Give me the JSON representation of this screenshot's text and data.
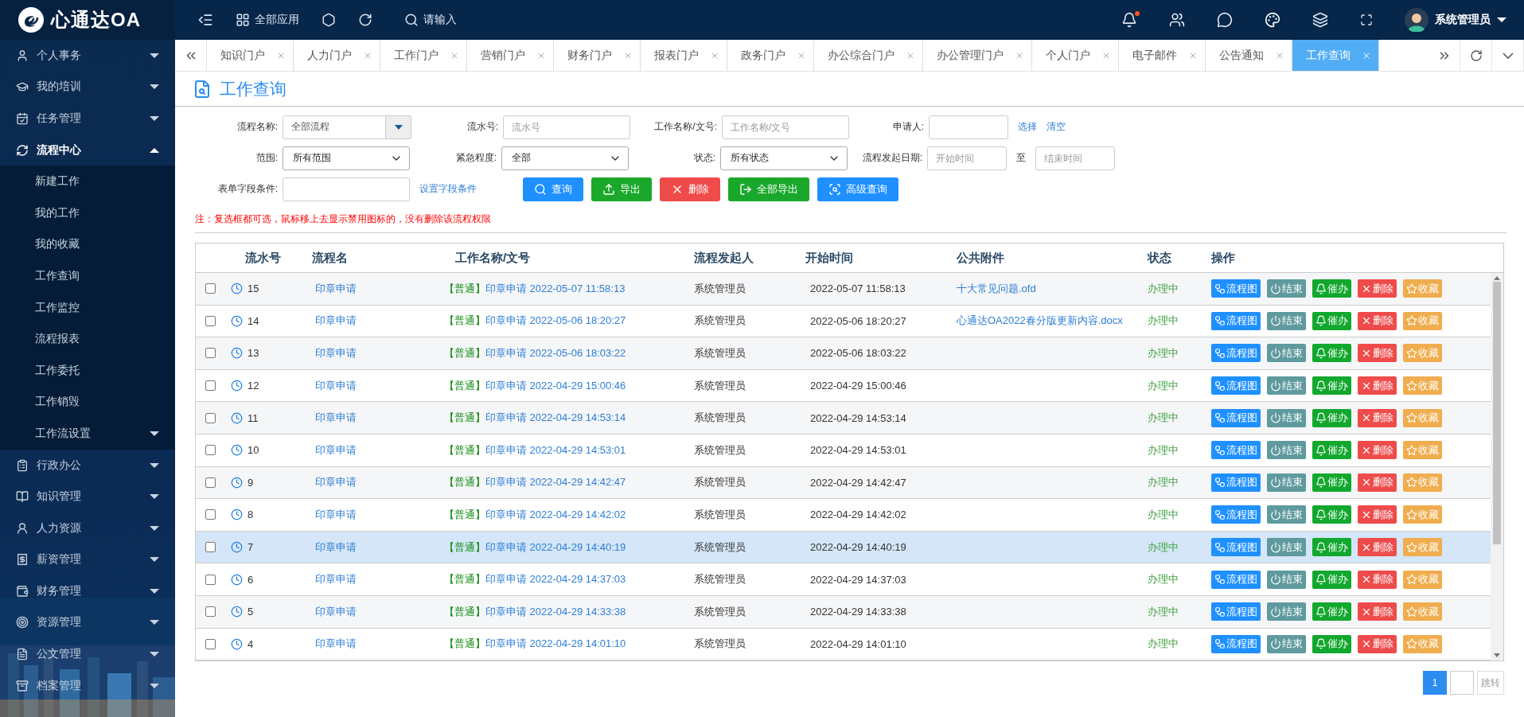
{
  "topbar": {
    "logo": "心通达OA",
    "apps_label": "全部应用",
    "search_placeholder": "请输入",
    "bell_unread": true,
    "user": "系统管理员"
  },
  "sidebar": {
    "items": [
      {
        "label": "个人事务",
        "expanded": false
      },
      {
        "label": "我的培训",
        "expanded": false
      },
      {
        "label": "任务管理",
        "expanded": false
      },
      {
        "label": "流程中心",
        "expanded": true,
        "children": [
          {
            "label": "新建工作"
          },
          {
            "label": "我的工作"
          },
          {
            "label": "我的收藏"
          },
          {
            "label": "工作查询"
          },
          {
            "label": "工作监控"
          },
          {
            "label": "流程报表"
          },
          {
            "label": "工作委托"
          },
          {
            "label": "工作销毁"
          },
          {
            "label": "工作流设置",
            "expanded": false
          }
        ]
      },
      {
        "label": "行政办公",
        "expanded": false
      },
      {
        "label": "知识管理",
        "expanded": false
      },
      {
        "label": "人力资源",
        "expanded": false
      },
      {
        "label": "薪资管理",
        "expanded": false
      },
      {
        "label": "财务管理",
        "expanded": false
      },
      {
        "label": "资源管理",
        "expanded": false
      },
      {
        "label": "公文管理",
        "expanded": false
      },
      {
        "label": "档案管理",
        "expanded": false
      }
    ]
  },
  "tabs": [
    {
      "label": "知识门户",
      "selected": false
    },
    {
      "label": "人力门户",
      "selected": false
    },
    {
      "label": "工作门户",
      "selected": false
    },
    {
      "label": "营销门户",
      "selected": false
    },
    {
      "label": "财务门户",
      "selected": false
    },
    {
      "label": "报表门户",
      "selected": false
    },
    {
      "label": "政务门户",
      "selected": false
    },
    {
      "label": "办公综合门户",
      "selected": false
    },
    {
      "label": "办公管理门户",
      "selected": false
    },
    {
      "label": "个人门户",
      "selected": false
    },
    {
      "label": "电子邮件",
      "selected": false
    },
    {
      "label": "公告通知",
      "selected": false
    },
    {
      "label": "工作查询",
      "selected": true
    }
  ],
  "page_title": "工作查询",
  "filters": {
    "rows": [
      [
        {
          "label": "流程名称:",
          "kind": "combo",
          "value": "全部流程"
        },
        {
          "label": "流水号:",
          "kind": "input",
          "placeholder": "流水号"
        },
        {
          "label": "工作名称/文号:",
          "kind": "input",
          "placeholder": "工作名称/文号"
        },
        {
          "label": "申请人:",
          "kind": "input"
        },
        {
          "kind": "links",
          "links": [
            "选择",
            "清空"
          ]
        }
      ],
      [
        {
          "label": "范围:",
          "kind": "select",
          "value": "所有范围"
        },
        {
          "label": "紧急程度:",
          "kind": "select",
          "value": "全部"
        },
        {
          "label": "状态:",
          "kind": "select",
          "value": "所有状态"
        },
        {
          "label": "流程发起日期:",
          "kind": "input",
          "placeholder": "开始时间"
        },
        {
          "kind": "range",
          "text": "至",
          "placeholder": "结束时间"
        }
      ],
      [
        {
          "label": "表单字段条件:",
          "kind": "input"
        },
        {
          "kind": "link",
          "text": "设置字段条件"
        }
      ]
    ],
    "buttons": [
      {
        "label": "查询",
        "kind": "search"
      },
      {
        "label": "导出",
        "kind": "export"
      },
      {
        "label": "删除",
        "kind": "delete"
      },
      {
        "label": "全部导出",
        "kind": "export_all"
      },
      {
        "label": "高级查询",
        "kind": "advanced"
      }
    ],
    "note": "注：复选框都可选，鼠标移上去显示禁用图标的，没有删除该流程权限"
  },
  "table": {
    "columns": [
      "流水号",
      "流程名",
      "工作名称/文号",
      "流程发起人",
      "开始时间",
      "公共附件",
      "状态",
      "操作"
    ],
    "rows": [
      {
        "checked": false,
        "selected": false,
        "no": "15",
        "flow": "印章申请",
        "priority": "【普通】",
        "title": "印章申请 2022-05-07 11:58:13",
        "starter": "系统管理员",
        "start": "2022-05-07 11:58:13",
        "attachment": "十大常见问题.ofd",
        "status": "办理中",
        "actions": [
          {
            "label": "流程图",
            "kind": "chart"
          },
          {
            "label": "结束",
            "kind": "end"
          },
          {
            "label": "催办",
            "kind": "remind"
          },
          {
            "label": "删除",
            "kind": "delete"
          },
          {
            "label": "收藏",
            "kind": "favorite"
          }
        ]
      },
      {
        "checked": false,
        "selected": false,
        "no": "14",
        "flow": "印章申请",
        "priority": "【普通】",
        "title": "印章申请 2022-05-06 18:20:27",
        "starter": "系统管理员",
        "start": "2022-05-06 18:20:27",
        "attachment": "心通达OA2022春分版更新内容.docx",
        "status": "办理中",
        "actions": [
          {
            "label": "流程图",
            "kind": "chart"
          },
          {
            "label": "结束",
            "kind": "end"
          },
          {
            "label": "催办",
            "kind": "remind"
          },
          {
            "label": "删除",
            "kind": "delete"
          },
          {
            "label": "收藏",
            "kind": "favorite"
          }
        ]
      },
      {
        "checked": false,
        "selected": false,
        "no": "13",
        "flow": "印章申请",
        "priority": "【普通】",
        "title": "印章申请 2022-05-06 18:03:22",
        "starter": "系统管理员",
        "start": "2022-05-06 18:03:22",
        "status": "办理中",
        "actions": [
          {
            "label": "流程图",
            "kind": "chart"
          },
          {
            "label": "结束",
            "kind": "end"
          },
          {
            "label": "催办",
            "kind": "remind"
          },
          {
            "label": "删除",
            "kind": "delete"
          },
          {
            "label": "收藏",
            "kind": "favorite"
          }
        ]
      },
      {
        "checked": false,
        "selected": false,
        "no": "12",
        "flow": "印章申请",
        "priority": "【普通】",
        "title": "印章申请 2022-04-29 15:00:46",
        "starter": "系统管理员",
        "start": "2022-04-29 15:00:46",
        "status": "办理中",
        "actions": [
          {
            "label": "流程图",
            "kind": "chart"
          },
          {
            "label": "结束",
            "kind": "end"
          },
          {
            "label": "催办",
            "kind": "remind"
          },
          {
            "label": "删除",
            "kind": "delete"
          },
          {
            "label": "收藏",
            "kind": "favorite"
          }
        ]
      },
      {
        "checked": false,
        "selected": false,
        "no": "11",
        "flow": "印章申请",
        "priority": "【普通】",
        "title": "印章申请 2022-04-29 14:53:14",
        "starter": "系统管理员",
        "start": "2022-04-29 14:53:14",
        "status": "办理中",
        "actions": [
          {
            "label": "流程图",
            "kind": "chart"
          },
          {
            "label": "结束",
            "kind": "end"
          },
          {
            "label": "催办",
            "kind": "remind"
          },
          {
            "label": "删除",
            "kind": "delete"
          },
          {
            "label": "收藏",
            "kind": "favorite"
          }
        ]
      },
      {
        "checked": false,
        "selected": false,
        "no": "10",
        "flow": "印章申请",
        "priority": "【普通】",
        "title": "印章申请 2022-04-29 14:53:01",
        "starter": "系统管理员",
        "start": "2022-04-29 14:53:01",
        "status": "办理中",
        "actions": [
          {
            "label": "流程图",
            "kind": "chart"
          },
          {
            "label": "结束",
            "kind": "end"
          },
          {
            "label": "催办",
            "kind": "remind"
          },
          {
            "label": "删除",
            "kind": "delete"
          },
          {
            "label": "收藏",
            "kind": "favorite"
          }
        ]
      },
      {
        "checked": false,
        "selected": false,
        "no": "9",
        "flow": "印章申请",
        "priority": "【普通】",
        "title": "印章申请 2022-04-29 14:42:47",
        "starter": "系统管理员",
        "start": "2022-04-29 14:42:47",
        "status": "办理中",
        "actions": [
          {
            "label": "流程图",
            "kind": "chart"
          },
          {
            "label": "结束",
            "kind": "end"
          },
          {
            "label": "催办",
            "kind": "remind"
          },
          {
            "label": "删除",
            "kind": "delete"
          },
          {
            "label": "收藏",
            "kind": "favorite"
          }
        ]
      },
      {
        "checked": false,
        "selected": false,
        "no": "8",
        "flow": "印章申请",
        "priority": "【普通】",
        "title": "印章申请 2022-04-29 14:42:02",
        "starter": "系统管理员",
        "start": "2022-04-29 14:42:02",
        "status": "办理中",
        "actions": [
          {
            "label": "流程图",
            "kind": "chart"
          },
          {
            "label": "结束",
            "kind": "end"
          },
          {
            "label": "催办",
            "kind": "remind"
          },
          {
            "label": "删除",
            "kind": "delete"
          },
          {
            "label": "收藏",
            "kind": "favorite"
          }
        ]
      },
      {
        "checked": false,
        "selected": true,
        "no": "7",
        "flow": "印章申请",
        "priority": "【普通】",
        "title": "印章申请 2022-04-29 14:40:19",
        "starter": "系统管理员",
        "start": "2022-04-29 14:40:19",
        "status": "办理中",
        "actions": [
          {
            "label": "流程图",
            "kind": "chart"
          },
          {
            "label": "结束",
            "kind": "end"
          },
          {
            "label": "催办",
            "kind": "remind"
          },
          {
            "label": "删除",
            "kind": "delete"
          },
          {
            "label": "收藏",
            "kind": "favorite"
          }
        ]
      },
      {
        "checked": false,
        "selected": false,
        "no": "6",
        "flow": "印章申请",
        "priority": "【普通】",
        "title": "印章申请 2022-04-29 14:37:03",
        "starter": "系统管理员",
        "start": "2022-04-29 14:37:03",
        "status": "办理中",
        "actions": [
          {
            "label": "流程图",
            "kind": "chart"
          },
          {
            "label": "结束",
            "kind": "end"
          },
          {
            "label": "催办",
            "kind": "remind"
          },
          {
            "label": "删除",
            "kind": "delete"
          },
          {
            "label": "收藏",
            "kind": "favorite"
          }
        ]
      },
      {
        "checked": false,
        "selected": false,
        "no": "5",
        "flow": "印章申请",
        "priority": "【普通】",
        "title": "印章申请 2022-04-29 14:33:38",
        "starter": "系统管理员",
        "start": "2022-04-29 14:33:38",
        "status": "办理中",
        "actions": [
          {
            "label": "流程图",
            "kind": "chart"
          },
          {
            "label": "结束",
            "kind": "end"
          },
          {
            "label": "催办",
            "kind": "remind"
          },
          {
            "label": "删除",
            "kind": "delete"
          },
          {
            "label": "收藏",
            "kind": "favorite"
          }
        ]
      },
      {
        "checked": false,
        "selected": false,
        "no": "4",
        "flow": "印章申请",
        "priority": "【普通】",
        "title": "印章申请 2022-04-29 14:01:10",
        "starter": "系统管理员",
        "start": "2022-04-29 14:01:10",
        "status": "办理中",
        "actions": [
          {
            "label": "流程图",
            "kind": "chart"
          },
          {
            "label": "结束",
            "kind": "end"
          },
          {
            "label": "催办",
            "kind": "remind"
          },
          {
            "label": "删除",
            "kind": "delete"
          },
          {
            "label": "收藏",
            "kind": "favorite"
          }
        ]
      }
    ]
  },
  "pagination": {
    "pages": [
      {
        "label": "1",
        "selected": true
      }
    ],
    "jump": "跳转"
  }
}
